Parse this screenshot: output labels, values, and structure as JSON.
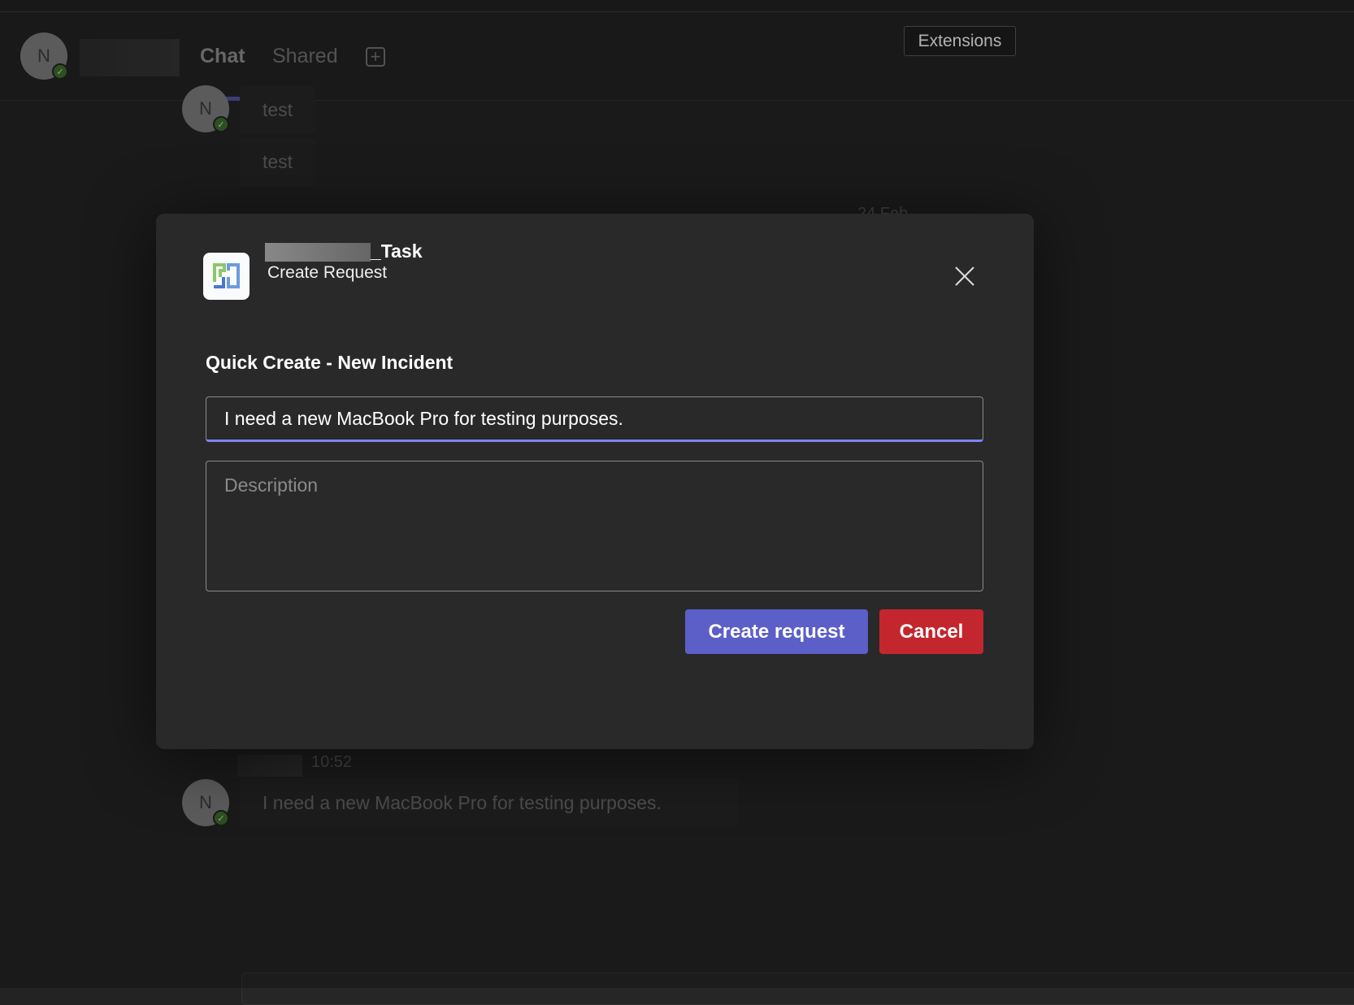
{
  "header": {
    "avatar_initial": "N",
    "tabs": [
      {
        "label": "Chat",
        "active": true
      },
      {
        "label": "Shared",
        "active": false
      }
    ],
    "add_tab_icon": "plus-square-icon",
    "tooltip": "Extensions"
  },
  "messages": [
    {
      "avatar_initial": "N",
      "text": "test"
    },
    {
      "text": "test"
    },
    {
      "timestamp": "10:52",
      "avatar_initial": "N",
      "text": "I need a new MacBook Pro for testing purposes."
    }
  ],
  "date_divider_partial": "24 Feb",
  "dialog": {
    "app_name_suffix": "_Task",
    "subtitle": "Create Request",
    "heading": "Quick Create - New Incident",
    "title_value": "I need a new MacBook Pro for testing purposes.",
    "description_placeholder": "Description",
    "create_label": "Create request",
    "cancel_label": "Cancel",
    "colors": {
      "primary": "#5b5fc7",
      "danger": "#c4262e",
      "focus": "#7f85f5"
    }
  }
}
